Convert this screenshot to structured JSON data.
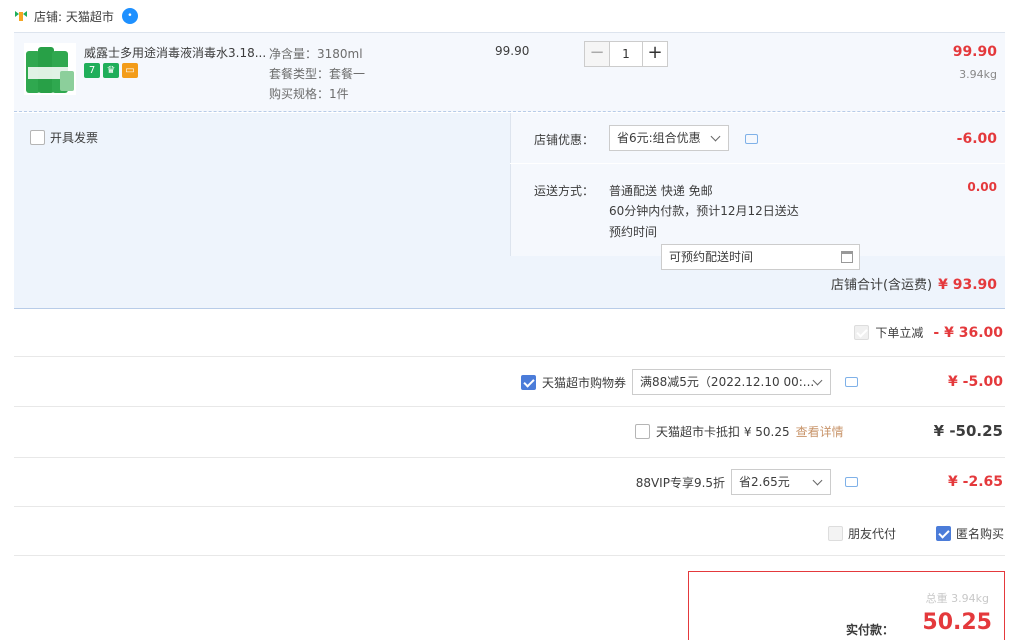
{
  "shop": {
    "label": "店铺: 天猫超市"
  },
  "item": {
    "title": "威露士多用途消毒液消毒水3.18...",
    "sku": [
      "净含量：3180ml",
      "套餐类型：套餐一",
      "购买规格：1件"
    ],
    "unit_price": "99.90",
    "quantity": "1",
    "minus": "−",
    "plus": "+",
    "total": "99.90",
    "weight": "3.94kg",
    "badges": [
      {
        "text": "7",
        "color": "#1fae5a"
      },
      {
        "text": "♛",
        "color": "#1fae5a"
      },
      {
        "text": "▭",
        "color": "#f39c19"
      }
    ]
  },
  "invoice": {
    "label": "开具发票"
  },
  "shop_discount": {
    "label": "店铺优惠：",
    "selected": "省6元:组合优惠",
    "amount": "-6.00"
  },
  "delivery": {
    "label": "运送方式：",
    "method": "普通配送 快递 免邮",
    "eta": "60分钟内付款，预计12月12日送达",
    "appointment_label": "预约时间",
    "appointment_placeholder": "可预约配送时间",
    "amount": "0.00"
  },
  "shop_total": {
    "label": "店铺合计(含运费)",
    "value": "¥ 93.90"
  },
  "instant_discount": {
    "label": "下单立减",
    "value": "- ¥ 36.00"
  },
  "coupon": {
    "label": "天猫超市购物券",
    "selected": "满88减5元（2022.12.10 00:...",
    "value": "¥ -5.00"
  },
  "card": {
    "label": "天猫超市卡抵扣 ¥ 50.25",
    "link": "查看详情",
    "value": "¥ -50.25"
  },
  "vip": {
    "label": "88VIP专享9.5折",
    "selected": "省2.65元",
    "value": "¥ -2.65"
  },
  "friend_pay": {
    "label": "朋友代付"
  },
  "anonymous": {
    "label": "匿名购买"
  },
  "payment": {
    "ghost": "总重 3.94kg",
    "label": "实付款：",
    "amount": "50.25"
  }
}
